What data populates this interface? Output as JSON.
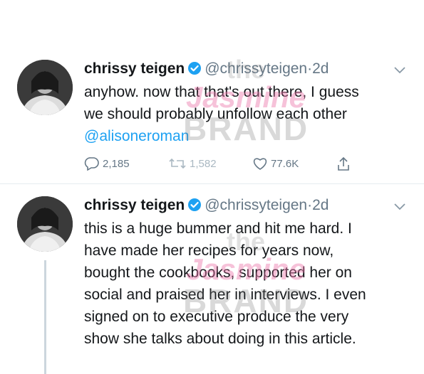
{
  "tweets": [
    {
      "name": "chrissy teigen",
      "handle": "@chrissyteigen",
      "dot": "·",
      "time": "2d",
      "lines": [
        "anyhow. now that that's out there, I guess",
        "we should probably unfollow each other"
      ],
      "mention": "@alisoneroman",
      "actions": {
        "replies": "2,185",
        "retweets": "1,582",
        "likes": "77.6K"
      }
    },
    {
      "name": "chrissy teigen",
      "handle": "@chrissyteigen",
      "dot": "·",
      "time": "2d",
      "lines": [
        "this is a huge bummer and hit me hard. I",
        "have made her recipes for years now,",
        "bought the cookbooks, supported her on",
        "social and praised her in interviews. I even",
        "signed on to executive produce the very",
        "show she talks about doing in this article."
      ]
    }
  ],
  "watermark": {
    "line1": "the",
    "line2": "Jasmine",
    "line3": "BRAND"
  },
  "colors": {
    "text": "#14171a",
    "secondary": "#657786",
    "accent": "#1da1f2",
    "divider": "#e6ecf0"
  }
}
